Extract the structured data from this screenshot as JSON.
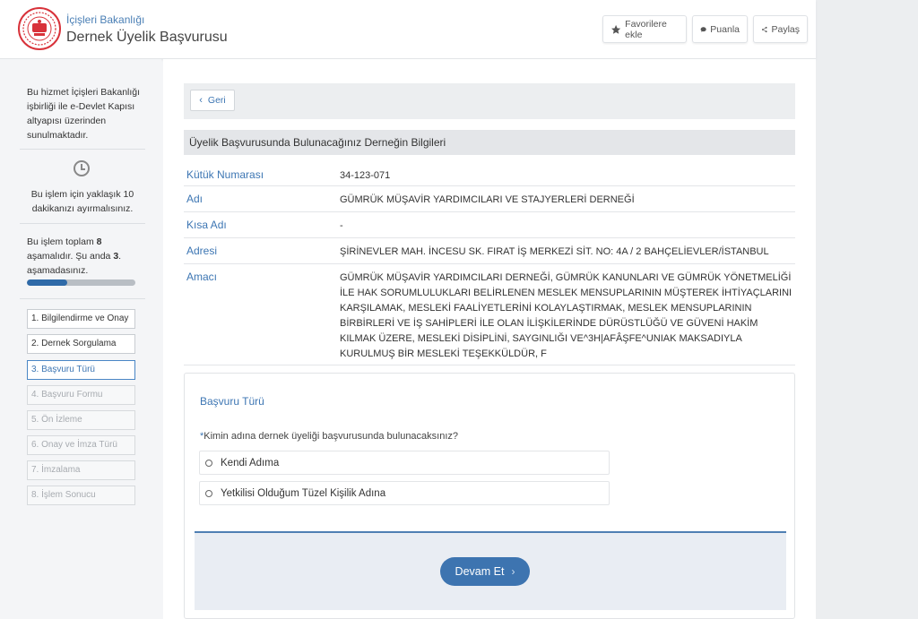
{
  "header": {
    "ministry": "İçişleri Bakanlığı",
    "service_title": "Dernek Üyelik Başvurusu",
    "favorite_label": "Favorilere ekle",
    "rate_label": "Puanla",
    "share_label": "Paylaş",
    "logo_icon": "ministry-seal-icon"
  },
  "sidebar": {
    "info": "Bu hizmet İçişleri Bakanlığı işbirliği ile e-Devlet Kapısı altyapısı üzerinden sunulmaktadır.",
    "time_text": "Bu işlem için yaklaşık 10 dakikanızı ayırmalısınız.",
    "steps_prefix": "Bu işlem toplam ",
    "steps_total": "8",
    "steps_middle": " aşamalıdır. Şu anda ",
    "steps_current": "3",
    "steps_suffix": ". aşamadasınız.",
    "progress_fraction": 0.375,
    "steps": [
      {
        "label": "1. Bilgilendirme ve Onay",
        "state": "done"
      },
      {
        "label": "2. Dernek Sorgulama",
        "state": "done"
      },
      {
        "label": "3. Başvuru Türü",
        "state": "active"
      },
      {
        "label": "4. Başvuru Formu",
        "state": "pending"
      },
      {
        "label": "5. Ön İzleme",
        "state": "pending"
      },
      {
        "label": "6. Onay ve İmza Türü",
        "state": "pending"
      },
      {
        "label": "7. İmzalama",
        "state": "pending"
      },
      {
        "label": "8. İşlem Sonucu",
        "state": "pending"
      }
    ]
  },
  "main": {
    "back_label": "Geri",
    "section_title": "Üyelik Başvurusunda Bulunacağınız Derneğin Bilgileri",
    "fields": [
      {
        "label": "Kütük Numarası",
        "value": "34-123-071"
      },
      {
        "label": "Adı",
        "value": "GÜMRÜK MÜŞAVİR YARDIMCILARI VE STAJYERLERİ DERNEĞİ"
      },
      {
        "label": "Kısa Adı",
        "value": "-"
      },
      {
        "label": "Adresi",
        "value": "ŞİRİNEVLER MAH. İNCESU SK. FIRAT İŞ MERKEZİ SİT. NO: 4A / 2 BAHÇELİEVLER/İSTANBUL"
      },
      {
        "label": "Amacı",
        "value": "GÜMRÜK MÜŞAVİR YARDIMCILARI DERNEĞİ, GÜMRÜK KANUNLARI VE GÜMRÜK YÖNETMELİĞİ İLE HAK SORUMLULUKLARI BELİRLENEN MESLEK MENSUPLARININ MÜŞTEREK İHTİYAÇLARINI KARŞILAMAK, MESLEKİ FAALİYETLERİNİ KOLAYLAŞTIRMAK, MESLEK MENSUPLARININ BİRBİRLERİ VE İŞ SAHİPLERİ İLE OLAN İLİŞKİLERİNDE DÜRÜSTLÜĞÜ VE GÜVENİ HAKİM KILMAK ÜZERE, MESLEKİ DİSİPLİNİ, SAYGINLIĞI VE^3H|AFÂŞFE^UNIAK MAKSADIYLA KURULMUŞ BİR MESLEKİ TEŞEKKÜLDÜR, F"
      }
    ],
    "card_title": "Başvuru Türü",
    "question_required_mark": "*",
    "question": "Kimin adına dernek üyeliği başvurusunda bulunacaksınız?",
    "options": [
      "Kendi Adıma",
      "Yetkilisi Olduğum Tüzel Kişilik Adına"
    ],
    "continue_label": "Devam Et"
  }
}
